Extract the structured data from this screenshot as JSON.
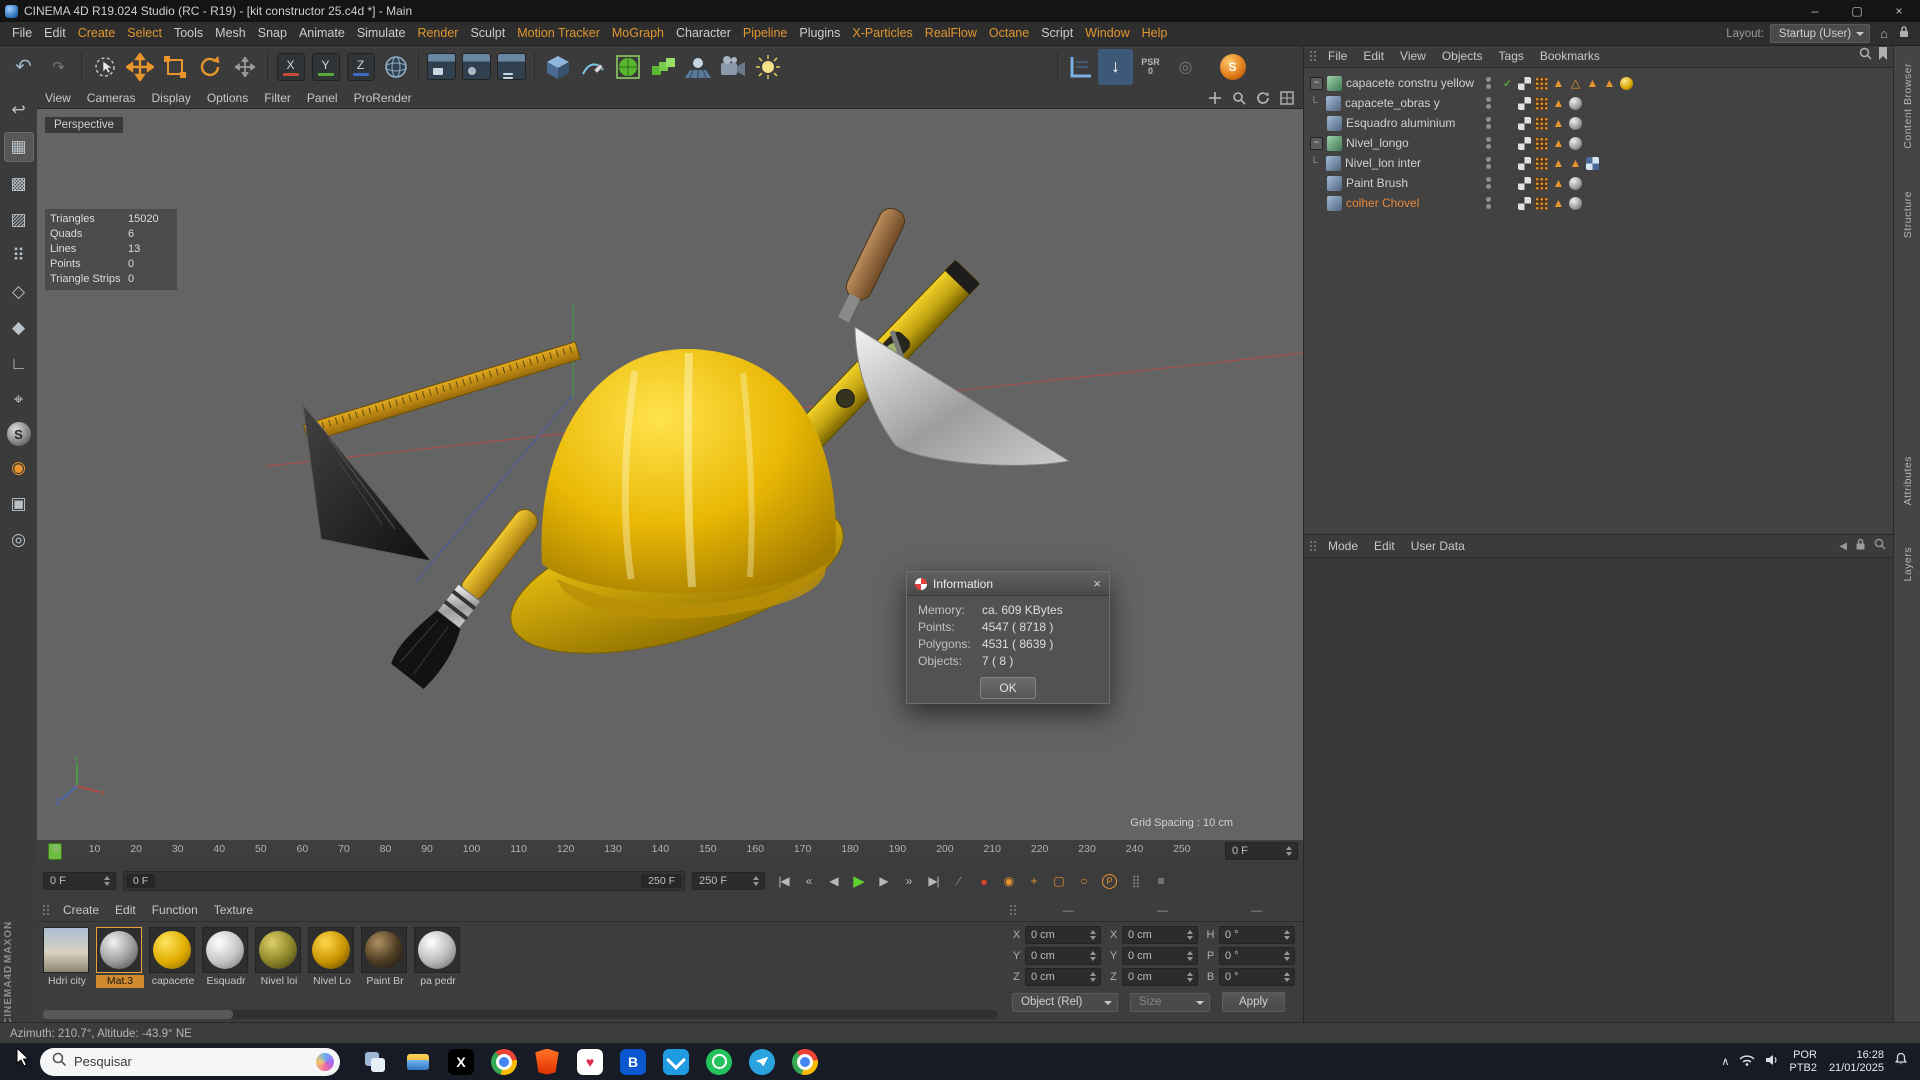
{
  "window": {
    "title": "CINEMA 4D R19.024 Studio (RC - R19) - [kit constructor 25.c4d *] - Main",
    "minimize": "–",
    "maximize": "▢",
    "close": "×"
  },
  "menubar": {
    "items": [
      {
        "label": "File"
      },
      {
        "label": "Edit"
      },
      {
        "label": "Create",
        "accent": true
      },
      {
        "label": "Select",
        "accent": true
      },
      {
        "label": "Tools"
      },
      {
        "label": "Mesh"
      },
      {
        "label": "Snap"
      },
      {
        "label": "Animate"
      },
      {
        "label": "Simulate"
      },
      {
        "label": "Render",
        "accent": true
      },
      {
        "label": "Sculpt"
      },
      {
        "label": "Motion Tracker",
        "accent": true
      },
      {
        "label": "MoGraph",
        "accent": true
      },
      {
        "label": "Character"
      },
      {
        "label": "Pipeline",
        "accent": true
      },
      {
        "label": "Plugins"
      },
      {
        "label": "X-Particles",
        "accent": true
      },
      {
        "label": "RealFlow",
        "accent": true
      },
      {
        "label": "Octane",
        "accent": true
      },
      {
        "label": "Script"
      },
      {
        "label": "Window",
        "accent": true
      },
      {
        "label": "Help",
        "accent": true
      }
    ],
    "layout_label": "Layout:",
    "layout_value": "Startup (User)"
  },
  "viewport": {
    "menu": [
      {
        "label": "View"
      },
      {
        "label": "Cameras"
      },
      {
        "label": "Display"
      },
      {
        "label": "Options"
      },
      {
        "label": "Filter"
      },
      {
        "label": "Panel"
      },
      {
        "label": "ProRender",
        "accent": true
      }
    ],
    "view_label": "Perspective",
    "stats": [
      {
        "name": "Triangles",
        "value": "15020"
      },
      {
        "name": "Quads",
        "value": "6"
      },
      {
        "name": "Lines",
        "value": "13"
      },
      {
        "name": "Points",
        "value": "0"
      },
      {
        "name": "Triangle Strips",
        "value": "0"
      }
    ],
    "grid_spacing": "Grid Spacing : 10 cm"
  },
  "dialog": {
    "title": "Information",
    "rows": [
      {
        "label": "Memory:",
        "value": "ca. 609 KBytes"
      },
      {
        "label": "Points:",
        "value": "4547 ( 8718 )"
      },
      {
        "label": "Polygons:",
        "value": "4531 ( 8639 )"
      },
      {
        "label": "Objects:",
        "value": "7 ( 8 )"
      }
    ],
    "ok_label": "OK"
  },
  "object_manager": {
    "menu": [
      {
        "label": "File"
      },
      {
        "label": "Edit"
      },
      {
        "label": "View"
      },
      {
        "label": "Objects"
      },
      {
        "label": "Tags"
      },
      {
        "label": "Bookmarks"
      }
    ],
    "objects": [
      {
        "name": "capacete constru yellow",
        "level": 0,
        "expander": true,
        "icon": "group",
        "check": "✓",
        "tags": [
          "checker",
          "dots",
          "tri",
          "tri_o",
          "tri",
          "tri",
          "ball_yellow"
        ]
      },
      {
        "name": "capacete_obras y",
        "level": 1,
        "icon": "mesh",
        "tags": [
          "checker",
          "dots",
          "tri",
          "ball_gray"
        ]
      },
      {
        "name": "Esquadro aluminium",
        "level": 0,
        "icon": "mesh",
        "tags": [
          "checker",
          "dots",
          "tri",
          "ball_gray"
        ]
      },
      {
        "name": "Nivel_longo",
        "level": 0,
        "expander": true,
        "icon": "group",
        "tags": [
          "checker",
          "dots",
          "tri",
          "ball_gray"
        ]
      },
      {
        "name": "Nivel_lon inter",
        "level": 1,
        "icon": "mesh",
        "tags": [
          "checker",
          "dots",
          "tri",
          "tri",
          "uvw"
        ]
      },
      {
        "name": "Paint Brush",
        "level": 0,
        "icon": "mesh",
        "tags": [
          "checker",
          "dots",
          "tri",
          "ball_gray"
        ]
      },
      {
        "name": "colher Chovel",
        "level": 0,
        "icon": "mesh",
        "selected": true,
        "tags": [
          "checker",
          "dots",
          "tri",
          "ball_gray"
        ]
      }
    ]
  },
  "attribute_manager": {
    "menu": [
      {
        "label": "Mode"
      },
      {
        "label": "Edit"
      },
      {
        "label": "User Data"
      }
    ]
  },
  "right_tabs": [
    "Content Browser",
    "Structure",
    "Attributes",
    "Layers"
  ],
  "timeline": {
    "ticks": [
      "0",
      "10",
      "20",
      "30",
      "40",
      "50",
      "60",
      "70",
      "80",
      "90",
      "100",
      "110",
      "120",
      "130",
      "140",
      "150",
      "160",
      "170",
      "180",
      "190",
      "200",
      "210",
      "220",
      "230",
      "240",
      "250"
    ],
    "ruler_spinner": "0 F"
  },
  "transport": {
    "frame_field": "0 F",
    "range_start": "0 F",
    "range_end": "250 F",
    "end_spinner": "250 F",
    "buttons": [
      {
        "name": "goto-start-button",
        "glyph": "|◀"
      },
      {
        "name": "prev-key-button",
        "glyph": "«"
      },
      {
        "name": "prev-frame-button",
        "glyph": "◀"
      },
      {
        "name": "play-button",
        "glyph": "▶",
        "cls": "play"
      },
      {
        "name": "next-frame-button",
        "glyph": "▶"
      },
      {
        "name": "next-key-button",
        "glyph": "»"
      },
      {
        "name": "goto-end-button",
        "glyph": "▶|"
      },
      {
        "name": "record-button",
        "glyph": "∕",
        "cls": "dim"
      },
      {
        "name": "autokey-button",
        "glyph": "●",
        "cls": "red"
      },
      {
        "name": "keyframe-selection-button",
        "glyph": "◉",
        "cls": "orange"
      },
      {
        "name": "position-key-button",
        "glyph": "+",
        "cls": "orange"
      },
      {
        "name": "scale-key-button",
        "glyph": "▢",
        "cls": "orange"
      },
      {
        "name": "rotation-key-button",
        "glyph": "○",
        "cls": "orange"
      },
      {
        "name": "parameter-key-button",
        "glyph": "P",
        "cls": "pcirc"
      },
      {
        "name": "pla-key-button",
        "glyph": "⣿",
        "cls": "dim"
      },
      {
        "name": "timeline-options-button",
        "glyph": "≡"
      }
    ]
  },
  "materials": {
    "menu": [
      {
        "label": "Create"
      },
      {
        "label": "Edit"
      },
      {
        "label": "Function"
      },
      {
        "label": "Texture"
      }
    ],
    "items": [
      {
        "name": "Hdri city",
        "style": "hdri"
      },
      {
        "name": "Mat.3",
        "style": "gray",
        "selected": true
      },
      {
        "name": "capacete",
        "style": "yellow"
      },
      {
        "name": "Esquadr",
        "style": "white"
      },
      {
        "name": "Nivel loi",
        "style": "olive"
      },
      {
        "name": "Nivel Lo",
        "style": "yellow2"
      },
      {
        "name": "Paint Br",
        "style": "dark"
      },
      {
        "name": "pa pedr",
        "style": "steel"
      }
    ]
  },
  "coordinates": {
    "headers": [
      "—",
      "—",
      "—"
    ],
    "rows": [
      {
        "l1": "X",
        "v1": "0 cm",
        "l2": "X",
        "v2": "0 cm",
        "l3": "H",
        "v3": "0 °"
      },
      {
        "l1": "Y",
        "v1": "0 cm",
        "l2": "Y",
        "v2": "0 cm",
        "l3": "P",
        "v3": "0 °"
      },
      {
        "l1": "Z",
        "v1": "0 cm",
        "l2": "Z",
        "v2": "0 cm",
        "l3": "B",
        "v3": "0 °"
      }
    ],
    "mode": "Object (Rel)",
    "size": "Size",
    "apply": "Apply"
  },
  "statusbar": "Azimuth: 210.7°,  Altitude: -43.9°   NE",
  "taskbar": {
    "search": "Pesquisar",
    "tray_lang1": "POR",
    "tray_lang2": "PTB2",
    "tray_time": "16:28",
    "tray_date": "21/01/2025"
  },
  "branding": {
    "line1": "MAXON",
    "line2": "CINEMA4D"
  },
  "icons": {
    "undo": "↶",
    "redo": "↷",
    "axis_x": "X",
    "axis_y": "Y",
    "axis_z": "Z",
    "snap_arrow": "↓",
    "psr": "PSR",
    "psr_sub": "0",
    "magnet": "◎",
    "s_ball": "S",
    "lp1": "↩",
    "lp2": "▦",
    "lp3": "▩",
    "lp4": "▨",
    "lp5": "⠿",
    "lp6": "◇",
    "lp7": "◆",
    "lp8": "∟",
    "lp9": "⌖",
    "lp10": "S",
    "lp11": "◉",
    "lp12": "▣",
    "lp13": "◎",
    "expander": "−",
    "tree": "└",
    "tri": "▲",
    "tri_o": "△",
    "heart": "♥",
    "b_app": "B",
    "x_app": "X",
    "home": "⌂",
    "chevron_up": "∧",
    "back": "◀"
  }
}
